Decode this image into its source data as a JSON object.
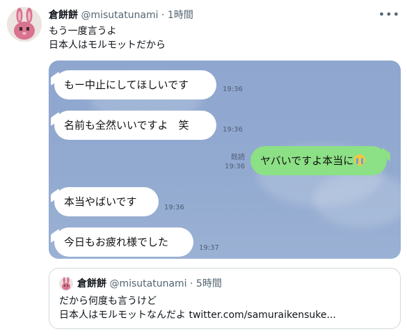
{
  "tweet": {
    "display_name": "倉餅餅",
    "handle": "@misutatunami",
    "separator": "·",
    "time": "1時間",
    "more_icon": "•••",
    "text": "もう一度言うよ\n日本人はモルモットだから"
  },
  "chat": {
    "messages": [
      {
        "text": "もー中止にしてほしいです",
        "time": "19:36",
        "side": "left"
      },
      {
        "text": "名前も全然いいですよ　笑",
        "time": "19:36",
        "side": "left"
      },
      {
        "text": "ヤバいですよ本当に",
        "emoji": "crying-face",
        "time": "19:36",
        "read": "既読",
        "side": "right"
      },
      {
        "text": "本当やばいです",
        "time": "19:36",
        "side": "left"
      },
      {
        "text": "今日もお疲れ様でした",
        "time": "19:37",
        "side": "left"
      }
    ]
  },
  "quote": {
    "display_name": "倉餅餅",
    "handle": "@misutatunami",
    "separator": "·",
    "time": "5時間",
    "text": "だから何度も言うけど\n日本人はモルモットなんだよ twitter.com/samuraikensuke..."
  },
  "colors": {
    "chat_background": "#92aad0",
    "sent_bubble": "#8ce085",
    "received_bubble": "#ffffff",
    "meta_gray": "#536471",
    "border": "#cfd9de",
    "avatar_bunny": "#d9738f"
  }
}
